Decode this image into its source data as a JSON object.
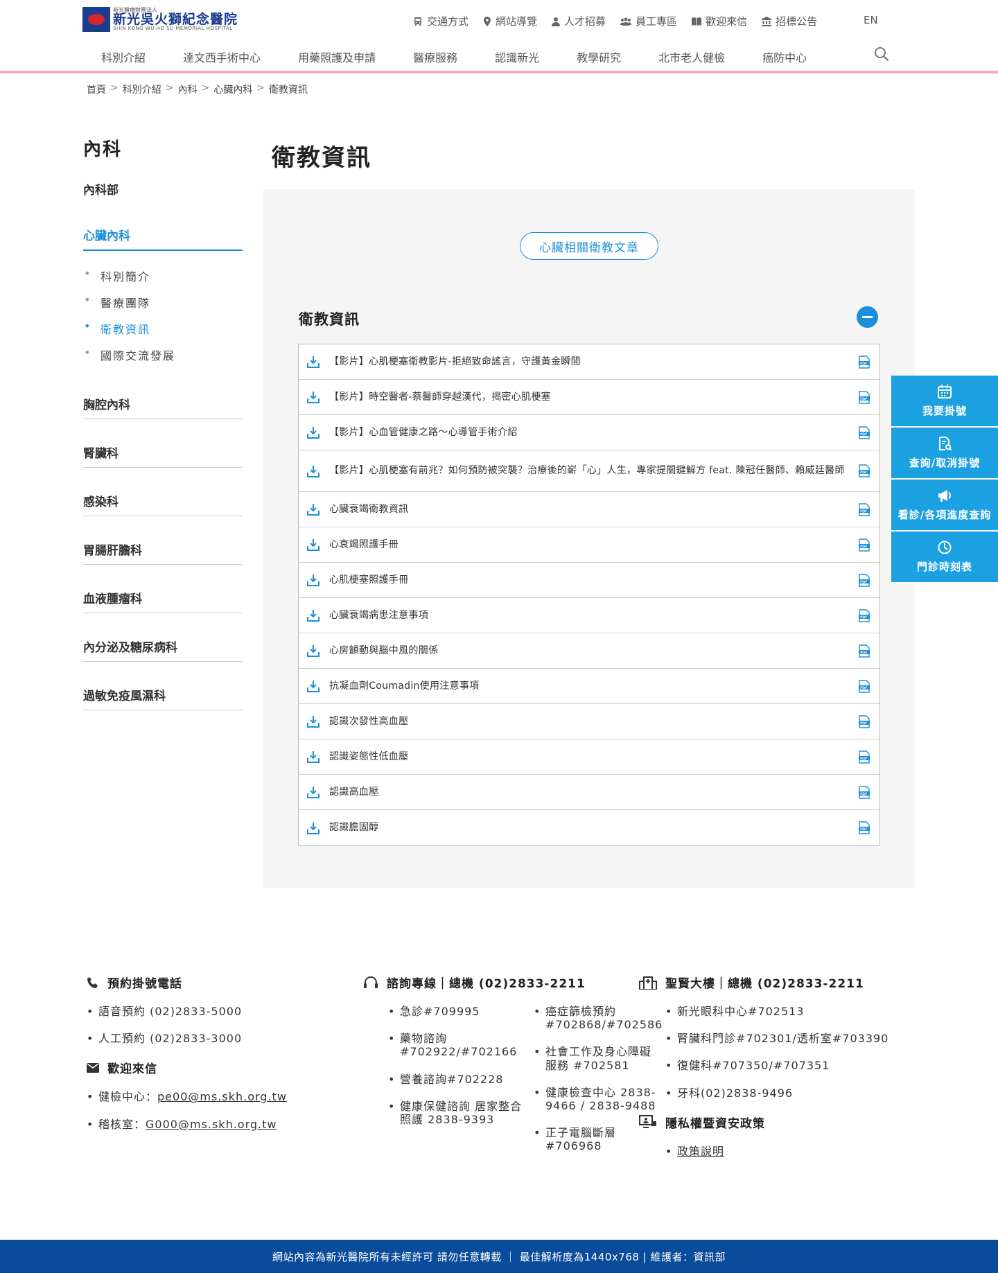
{
  "logo": {
    "small": "新光醫療財團法人",
    "main": "新光吳火獅紀念醫院",
    "en": "SHIN KONG WU HO SU MEMORIAL HOSPITAL"
  },
  "util_nav": [
    {
      "label": "交通方式",
      "icon": "bus-icon"
    },
    {
      "label": "網站導覽",
      "icon": "map-pin-icon"
    },
    {
      "label": "人才招募",
      "icon": "person-icon"
    },
    {
      "label": "員工專區",
      "icon": "group-icon"
    },
    {
      "label": "歡迎來信",
      "icon": "book-icon"
    },
    {
      "label": "招標公告",
      "icon": "bank-icon"
    }
  ],
  "lang": "EN",
  "main_nav": [
    "科別介紹",
    "達文西手術中心",
    "用藥照護及申請",
    "醫療服務",
    "認識新光",
    "教學研究",
    "北市老人健檢",
    "癌防中心"
  ],
  "breadcrumb": [
    "首頁",
    "科別介紹",
    "內科",
    "心臟內科",
    "衛教資訊"
  ],
  "breadcrumb_sep": ">",
  "sidebar": {
    "title": "內科",
    "top_item": "內科部",
    "active_cat": "心臟內科",
    "sub_items": [
      "科別簡介",
      "醫療團隊",
      "衛教資訊",
      "國際交流發展"
    ],
    "categories": [
      "胸腔內科",
      "腎臟科",
      "感染科",
      "胃腸肝膽科",
      "血液腫瘤科",
      "內分泌及糖尿病科",
      "過敏免疫風濕科"
    ]
  },
  "main": {
    "title": "衛教資訊",
    "pill_button": "心臟相關衛教文章",
    "section_title": "衛教資訊",
    "docs": [
      "【影片】心肌梗塞衛教影片-拒絕致命謠言，守護黃金瞬間",
      "【影片】時空醫者-蔡醫師穿越漢代，揭密心肌梗塞",
      "【影片】心血管健康之路～心導管手術介紹",
      "【影片】心肌梗塞有前兆？如何預防被突襲？治療後的嶄「心」人生，專家提關鍵解方 feat. 陳冠任醫師、賴威廷醫師",
      "心臟衰竭衛教資訊",
      "心衰竭照護手冊",
      "心肌梗塞照護手冊",
      "心臟衰竭病患注意事項",
      "心房顫動與腦中風的關係",
      "抗凝血劑Coumadin使用注意事項",
      "認識次發性高血壓",
      "認識姿態性低血壓",
      "認識高血壓",
      "認識膽固醇"
    ]
  },
  "float_panel": [
    {
      "label": "我要掛號",
      "icon": "calendar-icon"
    },
    {
      "label": "查詢/取消掛號",
      "icon": "document-search-icon"
    },
    {
      "label": "看診/各項進度查詢",
      "icon": "megaphone-icon"
    },
    {
      "label": "門診時刻表",
      "icon": "clock-icon"
    }
  ],
  "footer": {
    "booking": {
      "title": "預約掛號電話",
      "items": [
        "語音預約 (02)2833-5000",
        "人工預約 (02)2833-3000"
      ]
    },
    "mail": {
      "title": "歡迎來信",
      "items": [
        {
          "label": "健檢中心：",
          "link": "pe00@ms.skh.org.tw"
        },
        {
          "label": "稽核室：",
          "link": "G000@ms.skh.org.tw"
        }
      ]
    },
    "consult": {
      "title": "諮詢專線｜總機 (02)2833-2211",
      "col1": [
        "急診#709995",
        "藥物諮詢 #702922/#702166",
        "營養諮詢#702228",
        "健康保健諮詢 居家整合照護 2838-9393"
      ],
      "col2": [
        "癌症篩檢預約 #702868/#702586",
        "社會工作及身心障礙服務 #702581",
        "健康檢查中心 2838-9466 / 2838-9488",
        "正子電腦斷層 #706968"
      ]
    },
    "building": {
      "title": "聖賢大樓｜總機 (02)2833-2211",
      "items": [
        "新光眼科中心#702513",
        "腎臟科門診#702301/透析室#703390",
        "復健科#707350/#707351",
        "牙科(02)2838-9496"
      ]
    },
    "privacy": {
      "title": "隱私權暨資安政策",
      "link": "政策說明"
    },
    "bottom": "網站內容為新光醫院所有未經許可 請勿任意轉載 ｜ 最佳解析度為1440x768 | 維護者：資訊部"
  },
  "colors": {
    "accent": "#1b8fd9",
    "float_bg": "#1ba1e2",
    "header_line": "#f2a9c2",
    "bottom_bar": "#0a4c9a"
  }
}
